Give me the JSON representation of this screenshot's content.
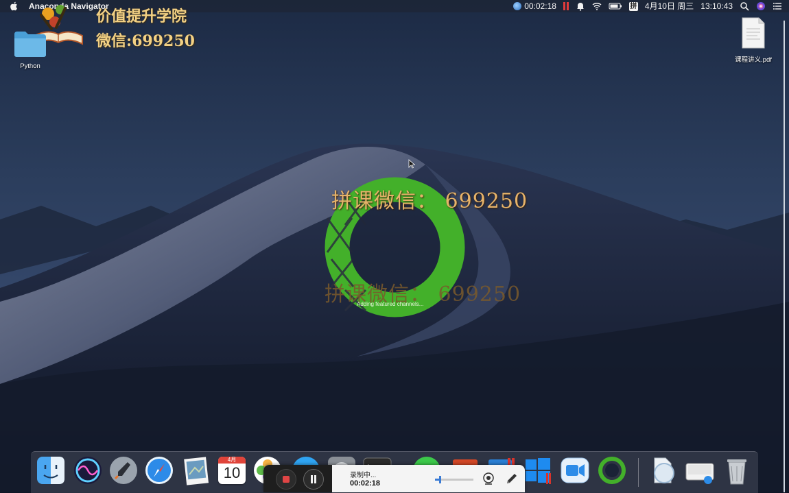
{
  "menubar": {
    "app_name": "Anaconda Navigator",
    "recording_time": "00:02:18",
    "ime_label": "拼",
    "date": "4月10日 周三",
    "time": "13:10:43"
  },
  "watermark": {
    "line1": "价值提升学院",
    "line2": "微信:699250",
    "center_line_1": "拼课微信：  699250",
    "center_line_2": "拼课微信：  699250"
  },
  "desktop_icons": {
    "python_folder": "Python",
    "pdf_file": "课程讲义.pdf"
  },
  "loader": {
    "status": "Adding featured channels..."
  },
  "recorder": {
    "status": "录制中...",
    "timer": "00:02:18"
  },
  "dock": {
    "calendar_month": "4月",
    "calendar_day": "10"
  },
  "colors": {
    "anaconda_green": "#43b02a",
    "record_red": "#e04545",
    "watermark_gold": "#f3d184"
  }
}
